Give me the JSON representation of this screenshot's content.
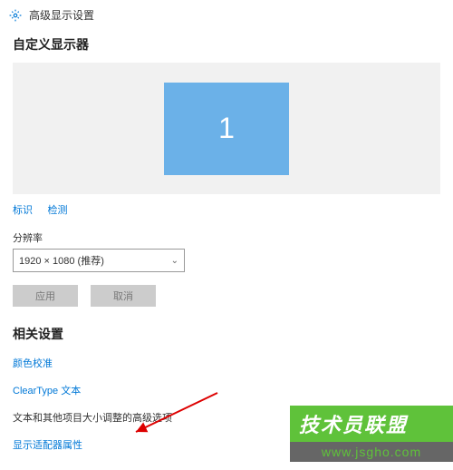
{
  "header": {
    "title": "高级显示设置"
  },
  "custom": {
    "title": "自定义显示器",
    "monitor_number": "1",
    "identify": "标识",
    "detect": "检测"
  },
  "resolution": {
    "label": "分辨率",
    "value": "1920 × 1080 (推荐)"
  },
  "buttons": {
    "apply": "应用",
    "cancel": "取消"
  },
  "related": {
    "title": "相关设置",
    "color_calibration": "颜色校准",
    "cleartype": "ClearType 文本",
    "advanced_sizing": "文本和其他项目大小调整的高级选项",
    "adapter": "显示适配器属性"
  },
  "watermark": {
    "brand": "技术员联盟",
    "url": "www.jsgho.com"
  }
}
